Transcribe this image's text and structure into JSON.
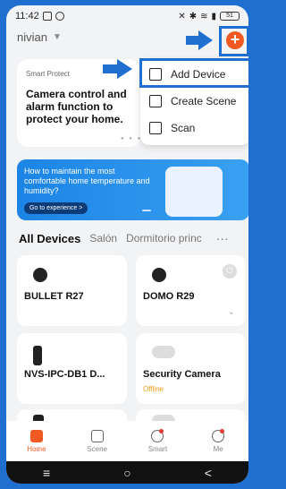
{
  "status": {
    "time": "11:42",
    "battery": "51"
  },
  "header": {
    "home_name": "nivian",
    "add_button_label": "+"
  },
  "smart_protect": {
    "title": "Smart Protect",
    "body": "Camera control and alarm function to protect your home."
  },
  "menu": {
    "items": [
      {
        "label": "Add Device",
        "icon": "add-device-icon"
      },
      {
        "label": "Create Scene",
        "icon": "create-scene-icon"
      },
      {
        "label": "Scan",
        "icon": "scan-icon"
      }
    ]
  },
  "banner": {
    "text": "How to maintain the most comfortable home temperature and humidity?",
    "cta": "Go to experience >"
  },
  "tabs": {
    "items": [
      "All Devices",
      "Salón",
      "Dormitorio princ"
    ],
    "more": "···"
  },
  "devices": [
    {
      "name": "BULLET R27",
      "status": ""
    },
    {
      "name": "DOMO R29",
      "status": ""
    },
    {
      "name": "NVS-IPC-DB1 D...",
      "status": ""
    },
    {
      "name": "Security Camera",
      "status": "Offline"
    }
  ],
  "navbar": {
    "items": [
      {
        "label": "Home",
        "icon": "home-icon",
        "active": true
      },
      {
        "label": "Scene",
        "icon": "scene-icon",
        "active": false
      },
      {
        "label": "Smart",
        "icon": "smart-icon",
        "active": false
      },
      {
        "label": "Me",
        "icon": "me-icon",
        "active": false
      }
    ]
  },
  "system_nav": {
    "menu": "≡",
    "home": "○",
    "back": "<"
  },
  "colors": {
    "accent": "#f05a22",
    "highlight": "#1f6fd1"
  }
}
